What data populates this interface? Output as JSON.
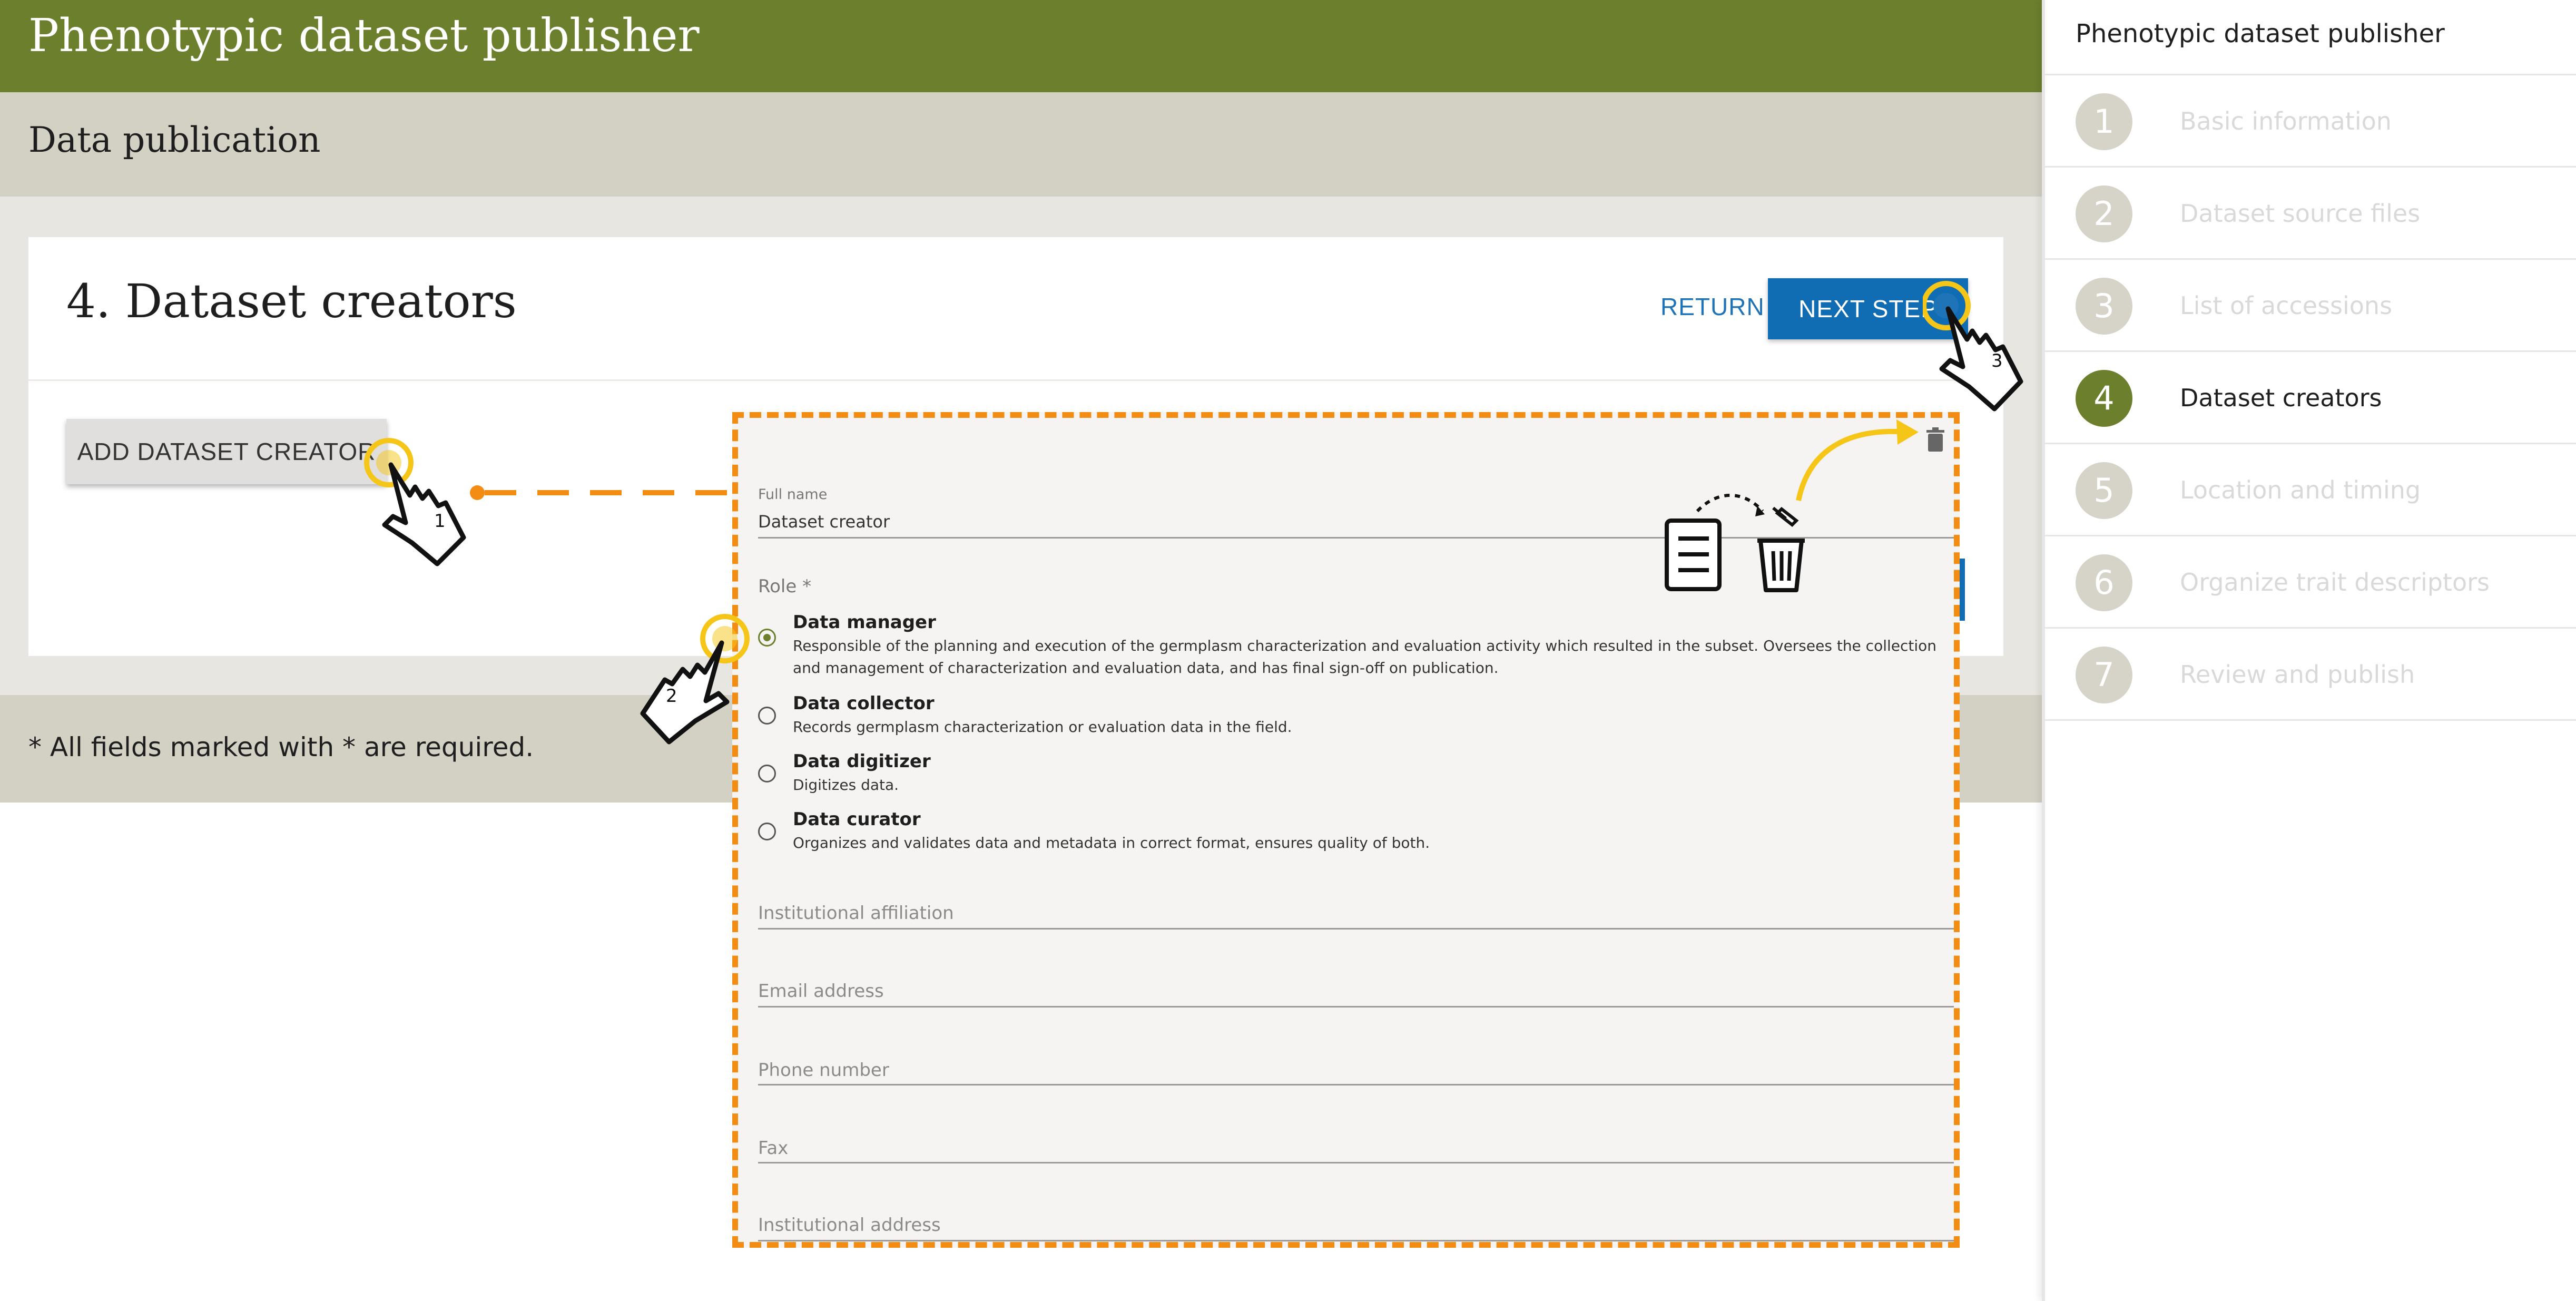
{
  "app": {
    "title": "Phenotypic dataset publisher"
  },
  "page": {
    "subtitle": "Data publication"
  },
  "card": {
    "heading": "4. Dataset creators",
    "return_label": "RETURN",
    "next_label": "NEXT STEP",
    "add_label": "ADD DATASET CREATOR"
  },
  "footer": {
    "required_note": "* All fields marked with * are required."
  },
  "sidebar": {
    "title": "Phenotypic dataset publisher",
    "steps": [
      {
        "num": "1",
        "label": "Basic information",
        "active": false
      },
      {
        "num": "2",
        "label": "Dataset source files",
        "active": false
      },
      {
        "num": "3",
        "label": "List of accessions",
        "active": false
      },
      {
        "num": "4",
        "label": "Dataset creators",
        "active": true
      },
      {
        "num": "5",
        "label": "Location and timing",
        "active": false
      },
      {
        "num": "6",
        "label": "Organize trait descriptors",
        "active": false
      },
      {
        "num": "7",
        "label": "Review and publish",
        "active": false
      }
    ]
  },
  "form": {
    "full_name_label": "Full name",
    "full_name_value": "Dataset creator",
    "role_label": "Role *",
    "roles": [
      {
        "title": "Data manager",
        "desc": "Responsible of the planning and execution of the germplasm characterization and evaluation activity which resulted in the subset. Oversees the collection and management of characterization and evaluation data, and has final sign-off on publication.",
        "selected": true
      },
      {
        "title": "Data collector",
        "desc": "Records germplasm characterization or evaluation data in the field.",
        "selected": false
      },
      {
        "title": "Data digitizer",
        "desc": "Digitizes data.",
        "selected": false
      },
      {
        "title": "Data curator",
        "desc": "Organizes and validates data and metadata in correct format, ensures quality of both.",
        "selected": false
      }
    ],
    "fields": [
      {
        "placeholder": "Institutional affiliation"
      },
      {
        "placeholder": "Email address"
      },
      {
        "placeholder": "Phone number"
      },
      {
        "placeholder": "Fax"
      },
      {
        "placeholder": "Institutional address"
      }
    ]
  },
  "annotations": {
    "step1": "1",
    "step2": "2",
    "step3": "3"
  },
  "colors": {
    "header": "#6c7f2d",
    "accent_blue": "#116db3",
    "annotation_orange": "#f28c12",
    "highlight_yellow": "#f5c518"
  },
  "icons": {
    "delete": "trash-icon",
    "pointer": "hand-pointer-icon",
    "document": "document-icon"
  }
}
